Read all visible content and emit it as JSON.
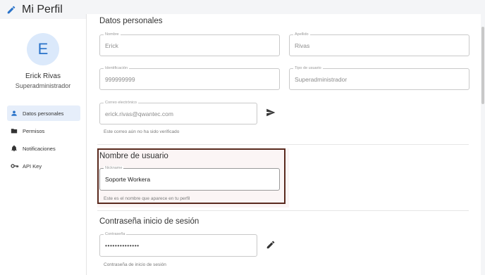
{
  "header": {
    "title": "Mi Perfil",
    "edit_icon": "pencil-icon"
  },
  "sidebar": {
    "avatar_letter": "E",
    "user_name": "Erick Rivas",
    "user_role": "Superadministrador",
    "items": [
      {
        "label": "Datos personales",
        "icon": "person-icon",
        "active": true
      },
      {
        "label": "Permisos",
        "icon": "folder-icon",
        "active": false
      },
      {
        "label": "Notificaciones",
        "icon": "bell-icon",
        "active": false
      },
      {
        "label": "API Key",
        "icon": "key-icon",
        "active": false
      }
    ]
  },
  "personal": {
    "heading": "Datos personales",
    "nombre": {
      "label": "Nombre",
      "value": "Erick"
    },
    "apellido": {
      "label": "Apellido",
      "value": "Rivas"
    },
    "identificacion": {
      "label": "Identificación",
      "value": "999999999"
    },
    "tipo_usuario": {
      "label": "Tipo de usuario",
      "value": "Superadministrador"
    },
    "correo": {
      "label": "Correo electrónico",
      "value": "erick.rivas@qwantec.com",
      "hint": "Este correo aún no ha sido verificado",
      "send_icon": "send-icon"
    }
  },
  "username": {
    "heading": "Nombre de usuario",
    "nickname": {
      "label": "Nickname",
      "value": "Soporte Workera"
    },
    "hint": "Este es el nombre que aparece en tu perfil"
  },
  "login_password": {
    "heading": "Contraseña inicio de sesión",
    "password": {
      "label": "Contraseña",
      "value": "••••••••••••••"
    },
    "hint": "Contraseña de inicio de sesión",
    "edit_icon": "pencil-icon"
  },
  "colors": {
    "accent": "#2a73c9",
    "highlight_border": "#5a2a1e",
    "active_nav": "#e6eefa"
  }
}
